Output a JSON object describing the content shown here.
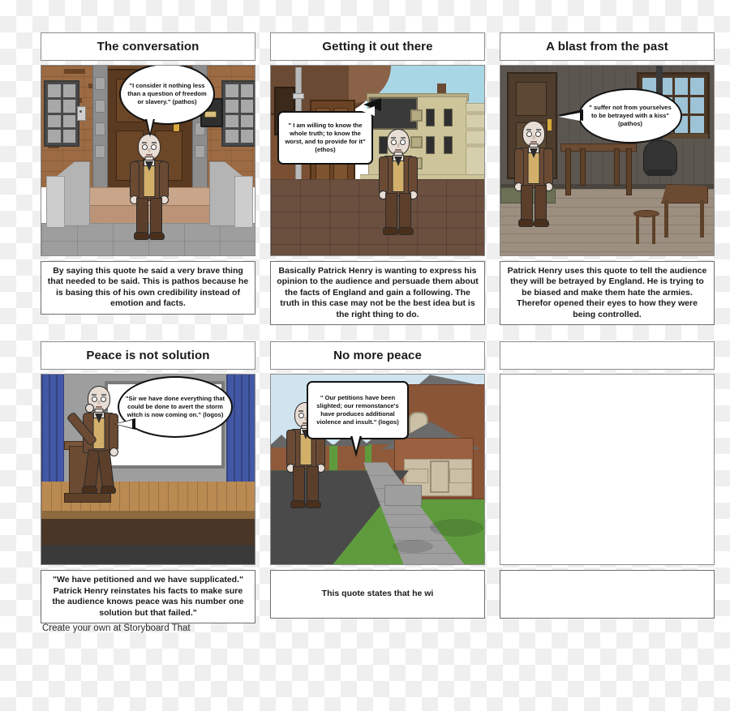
{
  "footer": {
    "text": "Create your own at Storyboard That"
  },
  "cells": [
    {
      "title": "The conversation",
      "scene": "brick-building-entrance",
      "bubble": "\"I consider it nothing less than a question of freedom or slavery.\" (pathos)",
      "caption": "By saying this quote he said a very brave thing that needed to be said. This is pathos because he is basing this of his own credibility instead of emotion and facts."
    },
    {
      "title": "Getting it out there",
      "scene": "city-street-archway",
      "bubble": "\" I am willing to know the whole truth; to know the worst, and to provide for it\" (ethos)",
      "caption": "Basically Patrick Henry is wanting to express his opinion to the audience and persuade them about the facts of England and gain a following. The truth in this case may not be the best idea but is the right thing to do."
    },
    {
      "title": "A blast from the past",
      "scene": "colonial-interior",
      "bubble": "\" suffer not from yourselves to be betrayed with a kiss\" (pathos)",
      "caption": "Patrick Henry uses this quote to tell the audience they will be betrayed by England. He is trying to be biased and make them hate the armies. Therefor opened their eyes to how they were being controlled."
    },
    {
      "title": "Peace is not solution",
      "scene": "stage-with-curtains",
      "bubble": "\"Sir we have done everything that could be done to avert the storm witch is now coming on.\" (logos)",
      "caption": "\"We have petitioned and we have supplicated.\" Patrick Henry reinstates his facts to make sure the audience knows peace was his number one solution but that failed.\""
    },
    {
      "title": "No more peace",
      "scene": "suburban-street",
      "bubble": "\" Our petitions have been slighted; our remonstance's have produces additional violence and insult.\" (logos)",
      "caption": "This quote states that he wi"
    },
    {
      "title": "",
      "scene": "empty",
      "bubble": "",
      "caption": ""
    }
  ]
}
